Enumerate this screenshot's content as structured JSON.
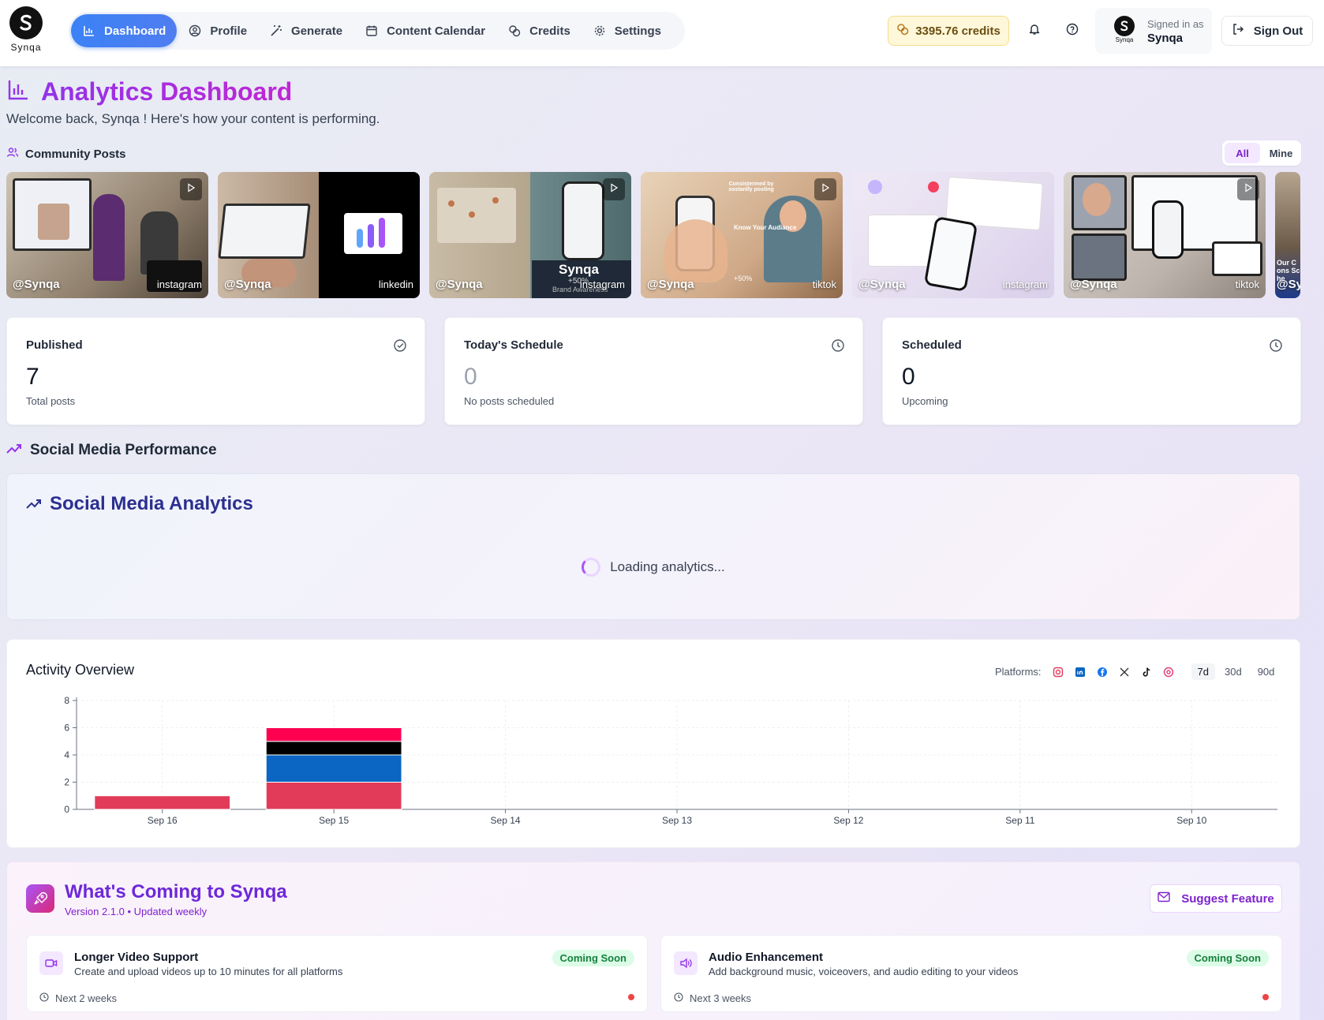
{
  "brand": {
    "name": "Synqa"
  },
  "nav": {
    "items": [
      {
        "label": "Dashboard",
        "icon": "bar-chart-icon",
        "active": true
      },
      {
        "label": "Profile",
        "icon": "user-circle-icon"
      },
      {
        "label": "Generate",
        "icon": "magic-wand-icon"
      },
      {
        "label": "Content Calendar",
        "icon": "calendar-icon"
      },
      {
        "label": "Credits",
        "icon": "coins-icon"
      },
      {
        "label": "Settings",
        "icon": "gear-icon"
      }
    ]
  },
  "header": {
    "credits": "3395.76 credits",
    "signed_in_label": "Signed in as",
    "signed_in_name": "Synqa",
    "sign_out": "Sign Out"
  },
  "page": {
    "title": "Analytics Dashboard",
    "welcome": "Welcome back, Synqa ! Here's how your content is performing."
  },
  "community": {
    "label": "Community Posts",
    "filters": [
      "All",
      "Mine"
    ],
    "active_filter": "All",
    "posts": [
      {
        "handle": "@Synqa",
        "platform": "instagram",
        "video": true
      },
      {
        "handle": "@Synqa",
        "platform": "linkedin",
        "video": false
      },
      {
        "handle": "@Synqa",
        "platform": "instagram",
        "video": true,
        "overlay": "Synqa",
        "overlay_sub": "+50%",
        "overlay_sub2": "Brand Awareness"
      },
      {
        "handle": "@Synqa",
        "platform": "tiktok",
        "video": true,
        "overlay": "Consistermed by sostanlly posting",
        "overlay_sub": "Know Your Audiance",
        "overlay_sub2": "+50%"
      },
      {
        "handle": "@Synqa",
        "platform": "instagram",
        "video": false
      },
      {
        "handle": "@Synqa",
        "platform": "tiktok",
        "video": true
      },
      {
        "handle": "@Sy",
        "platform": "",
        "video": false,
        "overlay": "Our Cons Sche"
      }
    ]
  },
  "stats": [
    {
      "label": "Published",
      "value": "7",
      "sub": "Total posts",
      "icon": "check-circle-icon"
    },
    {
      "label": "Today's Schedule",
      "value": "0",
      "sub": "No posts scheduled",
      "icon": "clock-icon"
    },
    {
      "label": "Scheduled",
      "value": "0",
      "sub": "Upcoming",
      "icon": "clock-icon"
    }
  ],
  "performance": {
    "label": "Social Media Performance",
    "card_title": "Social Media Analytics",
    "loading_text": "Loading analytics..."
  },
  "activity": {
    "title": "Activity Overview",
    "platforms_label": "Platforms:",
    "platforms": [
      "instagram",
      "linkedin",
      "facebook",
      "x",
      "tiktok",
      "threads"
    ],
    "ranges": [
      "7d",
      "30d",
      "90d"
    ],
    "active_range": "7d"
  },
  "colors": {
    "instagram": "#e23b5a",
    "linkedin": "#0a66c2",
    "facebook": "#1877f2",
    "x": "#000000",
    "tiktok": "#000000",
    "threads": "#e23b7a",
    "accent": "#3b82f6",
    "brand_purple": "#9333ea"
  },
  "chart_data": {
    "type": "bar",
    "stacked": true,
    "categories": [
      "Sep 16",
      "Sep 15",
      "Sep 14",
      "Sep 13",
      "Sep 12",
      "Sep 11",
      "Sep 10"
    ],
    "series": [
      {
        "values": [
          1,
          2,
          0,
          0,
          0,
          0,
          0
        ],
        "color": "#e23b5a"
      },
      {
        "values": [
          0,
          2,
          0,
          0,
          0,
          0,
          0
        ],
        "color": "#0a66c2"
      },
      {
        "values": [
          0,
          1,
          0,
          0,
          0,
          0,
          0
        ],
        "color": "#000000"
      },
      {
        "values": [
          0,
          1,
          0,
          0,
          0,
          0,
          0
        ],
        "color": "#ff0050"
      }
    ],
    "ylim": [
      0,
      8
    ],
    "yticks": [
      0,
      2,
      4,
      6,
      8
    ],
    "grid": true
  },
  "coming": {
    "title": "What's Coming to Synqa",
    "subtitle": "Version 2.1.0 • Updated weekly",
    "suggest": "Suggest Feature",
    "features": [
      {
        "title": "Longer Video Support",
        "desc": "Create and upload videos up to 10 minutes for all platforms",
        "badge": "Coming Soon",
        "eta": "Next 2 weeks",
        "icon": "video-icon"
      },
      {
        "title": "Audio Enhancement",
        "desc": "Add background music, voiceovers, and audio editing to your videos",
        "badge": "Coming Soon",
        "eta": "Next 3 weeks",
        "icon": "speaker-icon"
      }
    ]
  }
}
